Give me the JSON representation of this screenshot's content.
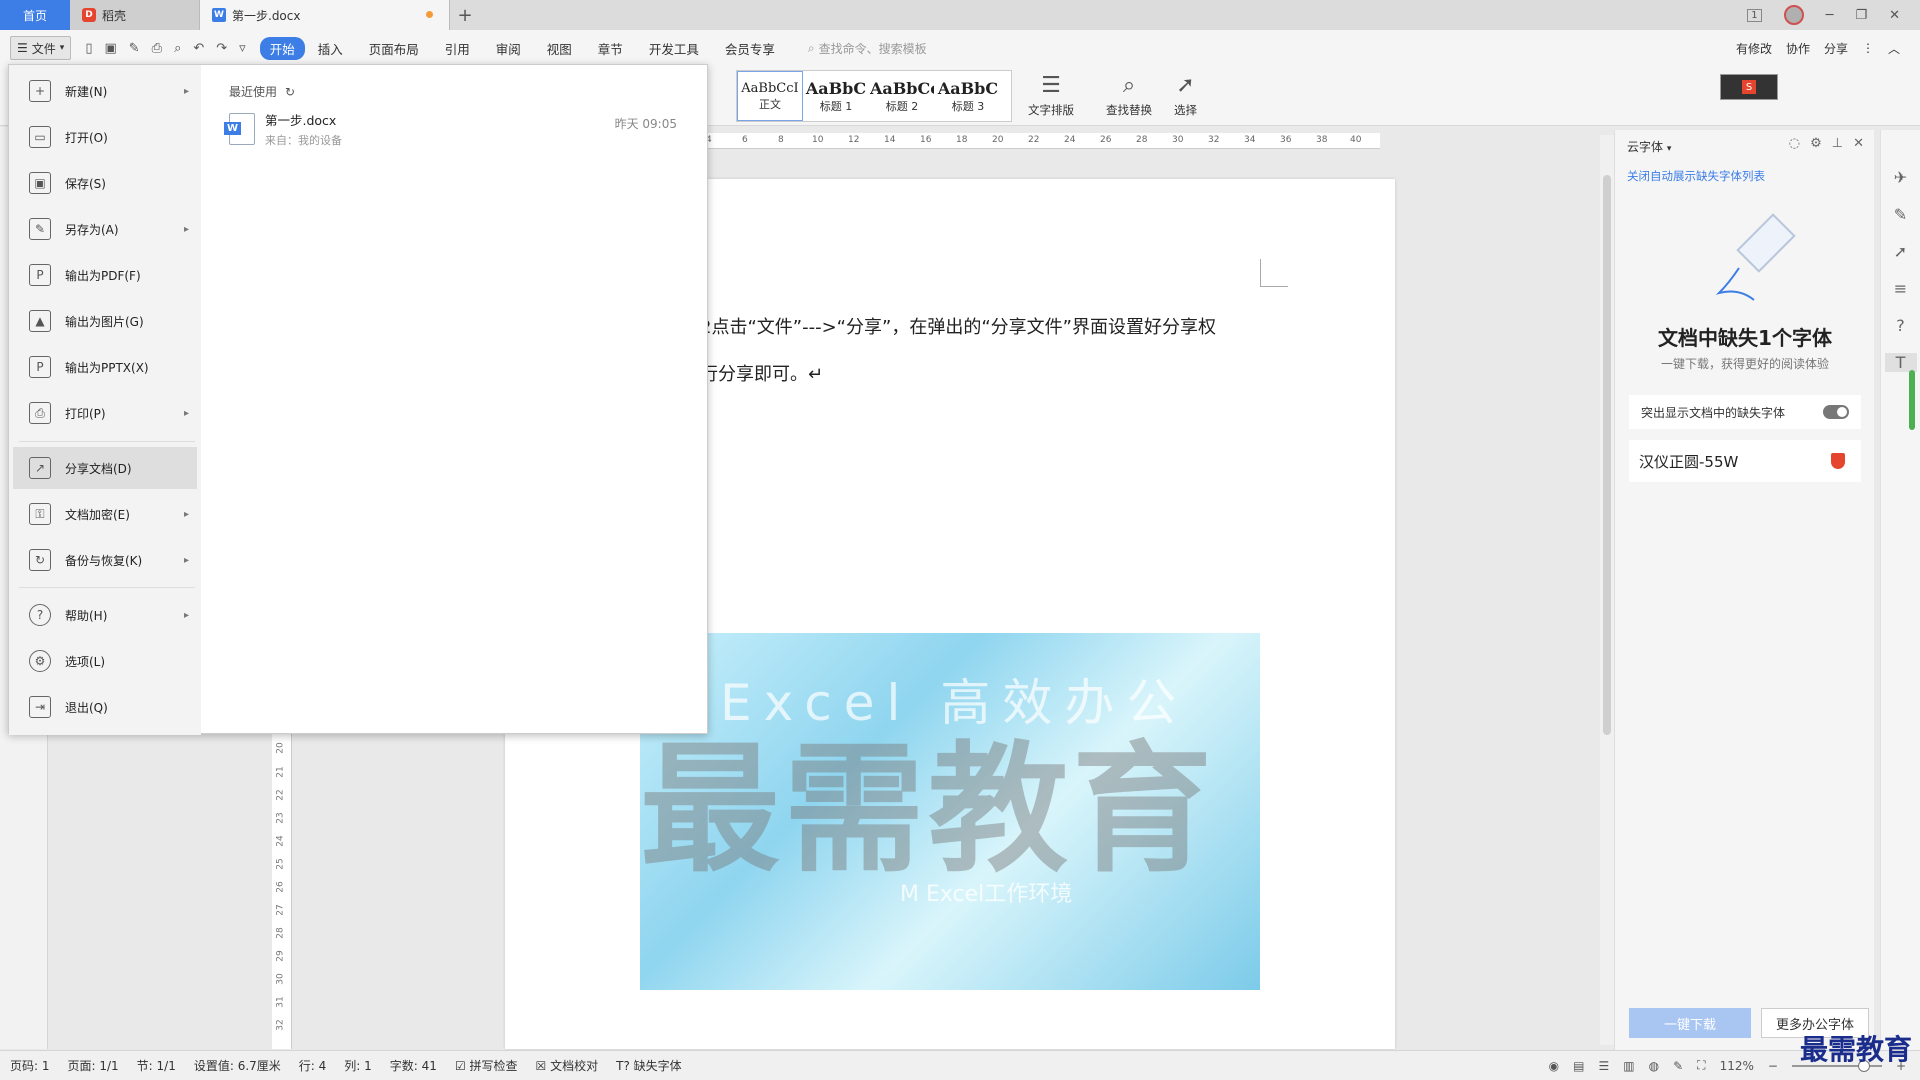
{
  "titlebar": {
    "home_tab": "首页",
    "draw_tab": "稻壳",
    "doc_tab": "第一步.docx",
    "new_tab": "+",
    "page_badge": "1"
  },
  "menu": {
    "file_label": "文件",
    "tabs": [
      "开始",
      "插入",
      "页面布局",
      "引用",
      "审阅",
      "视图",
      "章节",
      "开发工具",
      "会员专享"
    ],
    "search_placeholder": "查找命令、搜索模板",
    "actions": [
      "有修改",
      "协作",
      "分享"
    ]
  },
  "ribbon": {
    "styles": [
      {
        "sample": "AaBbCcI",
        "name": "正文"
      },
      {
        "sample": "AaBbC",
        "name": "标题 1"
      },
      {
        "sample": "AaBbCc",
        "name": "标题 2"
      },
      {
        "sample": "AaBbC",
        "name": "标题 3"
      }
    ],
    "tools": [
      "文字排版",
      "查找替换",
      "选择"
    ]
  },
  "ruler": {
    "h_ticks": [
      "4",
      "6",
      "8",
      "10",
      "12",
      "14",
      "16",
      "18",
      "20",
      "22",
      "24",
      "26",
      "28",
      "30",
      "32",
      "34",
      "36",
      "38",
      "40"
    ],
    "v_ticks": [
      "20",
      "21",
      "22",
      "23",
      "24",
      "25",
      "26",
      "27",
      "28",
      "29",
      "30",
      "31",
      "32"
    ]
  },
  "document": {
    "line1": "2点击“文件”--->“分享”，在弹出的“分享文件”界面设置好分享权",
    "line2": "行分享即可。↵",
    "image_caption": "M Excel工作环境",
    "image_top_text": "Excel 高效办公",
    "watermark": "最需教育"
  },
  "file_menu": {
    "items": [
      {
        "label": "新建(N)",
        "arrow": true
      },
      {
        "label": "打开(O)",
        "arrow": false
      },
      {
        "label": "保存(S)",
        "arrow": false
      },
      {
        "label": "另存为(A)",
        "arrow": true
      },
      {
        "label": "输出为PDF(F)",
        "arrow": false
      },
      {
        "label": "输出为图片(G)",
        "arrow": false
      },
      {
        "label": "输出为PPTX(X)",
        "arrow": false
      },
      {
        "label": "打印(P)",
        "arrow": true
      },
      {
        "label": "分享文档(D)",
        "arrow": false
      },
      {
        "label": "文档加密(E)",
        "arrow": true
      },
      {
        "label": "备份与恢复(K)",
        "arrow": true
      },
      {
        "label": "帮助(H)",
        "arrow": true
      },
      {
        "label": "选项(L)",
        "arrow": false
      },
      {
        "label": "退出(Q)",
        "arrow": false
      }
    ],
    "recent_title": "最近使用",
    "recent_file": {
      "name": "第一步.docx",
      "from": "来自：我的设备",
      "time": "昨天 09:05"
    }
  },
  "cloud_panel": {
    "header": "云字体",
    "link": "关闭自动展示缺失字体列表",
    "title": "文档中缺失1个字体",
    "subtitle": "一键下载，获得更好的阅读体验",
    "toggle_label": "突出显示文档中的缺失字体",
    "font_name": "汉仪正圆-55W",
    "download_all": "一键下载",
    "more_fonts": "更多办公字体"
  },
  "statusbar": {
    "items": [
      "页码: 1",
      "页面: 1/1",
      "节: 1/1",
      "设置值: 6.7厘米",
      "行: 4",
      "列: 1",
      "字数: 41",
      "拼写检查",
      "文档校对",
      "缺失字体"
    ],
    "zoom": "112%"
  },
  "corner_watermark": "最需教育"
}
